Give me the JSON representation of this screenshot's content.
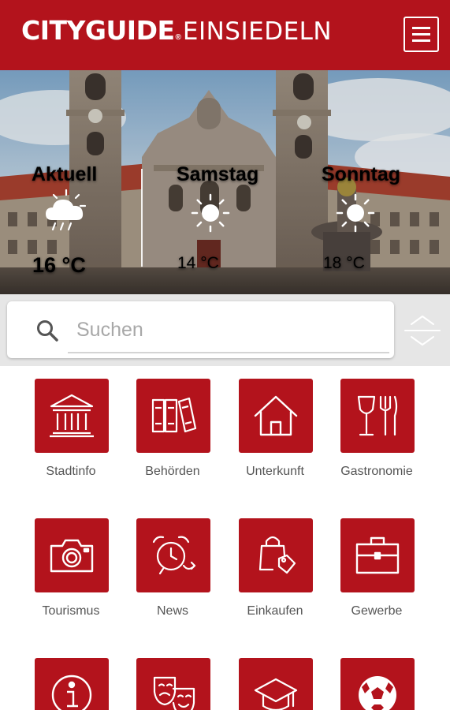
{
  "header": {
    "brand_main": "CITYGUIDE",
    "brand_reg": "®",
    "brand_city": "EINSIEDELN",
    "menu_icon": "hamburger-menu-icon",
    "color": "#b3131c"
  },
  "weather": [
    {
      "day": "Aktuell",
      "temp": "16 °C",
      "icon": "cloud-rain-icon"
    },
    {
      "day": "Samstag",
      "temp": "14 °C",
      "icon": "sun-icon"
    },
    {
      "day": "Sonntag",
      "temp": "18 °C",
      "icon": "sun-icon"
    }
  ],
  "search": {
    "placeholder": "Suchen",
    "value": "",
    "icon": "search-icon",
    "sort_icon": "sort-up-down-icon"
  },
  "categories": [
    {
      "label": "Stadtinfo",
      "icon": "building-columns-icon"
    },
    {
      "label": "Behörden",
      "icon": "binders-icon"
    },
    {
      "label": "Unterkunft",
      "icon": "house-icon"
    },
    {
      "label": "Gastronomie",
      "icon": "wine-cutlery-icon"
    },
    {
      "label": "Tourismus",
      "icon": "camera-icon"
    },
    {
      "label": "News",
      "icon": "alarm-clock-icon"
    },
    {
      "label": "Einkaufen",
      "icon": "shopping-bag-icon"
    },
    {
      "label": "Gewerbe",
      "icon": "briefcase-icon"
    },
    {
      "label": "",
      "icon": "info-icon"
    },
    {
      "label": "",
      "icon": "theater-masks-icon"
    },
    {
      "label": "",
      "icon": "graduation-cap-icon"
    },
    {
      "label": "",
      "icon": "soccer-ball-icon"
    }
  ]
}
